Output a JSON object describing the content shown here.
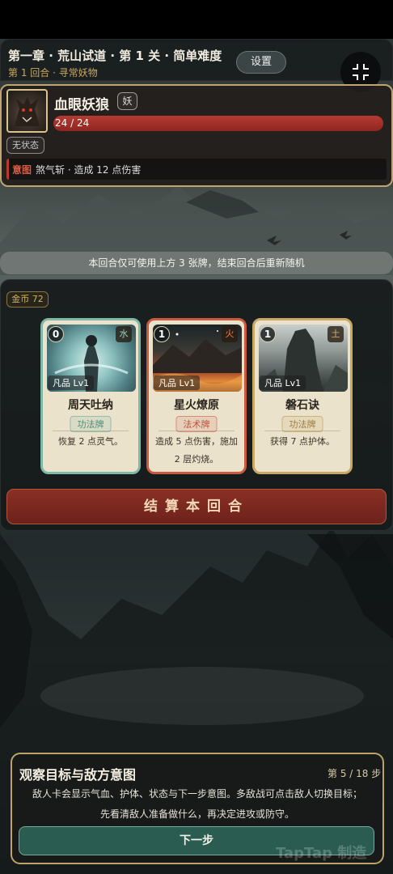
{
  "header": {
    "title": "第一章 · 荒山试道 · 第 1 关 · 简单难度",
    "subtitle": "第 1 回合 · 寻常妖物",
    "settings_label": "设置"
  },
  "enemy": {
    "name": "血眼妖狼",
    "tag": "妖",
    "hp_text": "24 / 24",
    "hp_fraction": 1.0,
    "status": "无状态",
    "intent_label": "意图",
    "intent_text": "煞气斩 · 造成 12 点伤害"
  },
  "notice": "本回合仅可使用上方 3 张牌，结束回合后重新随机",
  "gold_label": "金币 72",
  "cards": [
    {
      "cost": "0",
      "element": "水",
      "rank": "凡品 Lv1",
      "name": "周天吐纳",
      "type": "功法牌",
      "desc": "恢复 2 点灵气。",
      "border": "#7fb8a6",
      "type_color": "#4f8a7c"
    },
    {
      "cost": "1",
      "element": "火",
      "rank": "凡品 Lv1",
      "name": "星火燎原",
      "type": "法术牌",
      "desc": "造成 5 点伤害，施加 2 层灼烧。",
      "border": "#c9593f",
      "type_color": "#c1503c"
    },
    {
      "cost": "1",
      "element": "土",
      "rank": "凡品 Lv1",
      "name": "磐石诀",
      "type": "功法牌",
      "desc": "获得 7 点护体。",
      "border": "#c9a765",
      "type_color": "#9c7a3f"
    }
  ],
  "end_turn_label": "结算本回合",
  "tutorial": {
    "title": "观察目标与敌方意图",
    "step": "第 5 / 18 步",
    "line1": "敌人卡会显示气血、护体、状态与下一步意图。多敌战可点击敌人切换目标；",
    "line2": "先看清敌人准备做什么，再决定进攻或防守。",
    "next_label": "下一步"
  },
  "watermark": "TapTap 制造",
  "icons": {
    "fullscreen": "exit-fullscreen-icon"
  }
}
